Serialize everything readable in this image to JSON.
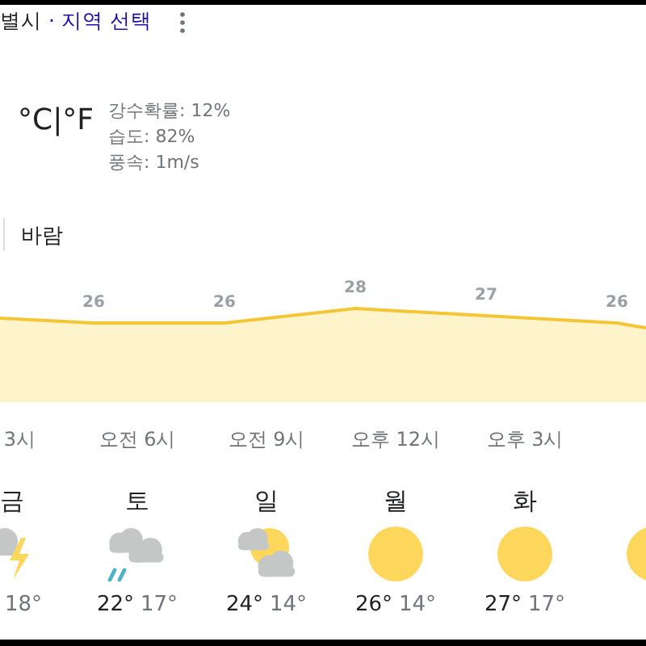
{
  "header": {
    "place": "별시",
    "link": "· 지역 선택"
  },
  "current": {
    "units": "°C|°F",
    "stats": [
      "강수확률: 12%",
      "습도: 82%",
      "풍속: 1m/s"
    ]
  },
  "tabs": [
    {
      "label": "바람",
      "selected": false
    }
  ],
  "temperature_labels": [
    "26",
    "26",
    "28",
    "27",
    "26"
  ],
  "hour_labels": [
    "3시",
    "오전 6시",
    "오전 9시",
    "오후 12시",
    "오후 3시"
  ],
  "days": [
    {
      "day": "금",
      "kind": "storm",
      "low": "18°"
    },
    {
      "day": "토",
      "kind": "rain",
      "high": "22°",
      "low": "17°"
    },
    {
      "day": "일",
      "kind": "partly",
      "high": "24°",
      "low": "14°"
    },
    {
      "day": "월",
      "kind": "sun",
      "high": "26°",
      "low": "14°"
    },
    {
      "day": "화",
      "kind": "sun",
      "high": "27°",
      "low": "17°"
    },
    {
      "kind": "sun"
    }
  ]
}
